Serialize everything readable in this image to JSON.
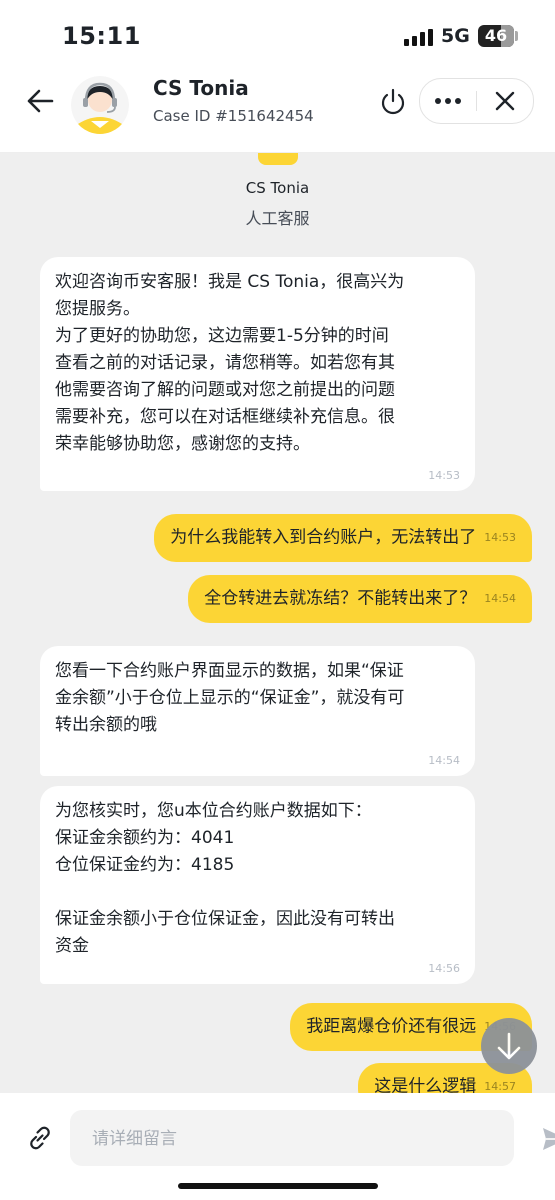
{
  "status_bar": {
    "time": "15:11",
    "network": "5G",
    "battery": "46"
  },
  "header": {
    "agent_name": "CS Tonia",
    "case_id": "Case ID #151642454"
  },
  "system": {
    "agent_name": "CS Tonia",
    "role": "人工客服"
  },
  "messages": [
    {
      "direction": "in",
      "text": "欢迎咨询币安客服！我是 CS Tonia，很高兴为\n您提服务。\n为了更好的协助您，这边需要1-5分钟的时间\n查看之前的对话记录，请您稍等。如若您有其\n他需要咨询了解的问题或对您之前提出的问题\n需要补充，您可以在对话框继续补充信息。很\n荣幸能够协助您，感谢您的支持。",
      "time": "14:53"
    },
    {
      "direction": "out",
      "text": "为什么我能转入到合约账户，无法转出了",
      "time": "14:53"
    },
    {
      "direction": "out",
      "text": "全仓转进去就冻结？不能转出来了？",
      "time": "14:54"
    },
    {
      "direction": "in",
      "text": "您看一下合约账户界面显示的数据，如果“保证\n金余额”小于仓位上显示的“保证金”，就没有可\n转出余额的哦",
      "time": "14:54"
    },
    {
      "direction": "in",
      "text": "为您核实时，您u本位合约账户数据如下：\n保证金余额约为：4041\n仓位保证金约为：4185\n\n保证金余额小于仓位保证金，因此没有可转出\n资金",
      "time": "14:56"
    },
    {
      "direction": "out",
      "text": "我距离爆仓价还有很远",
      "time": "14:56"
    },
    {
      "direction": "out",
      "text": "这是什么逻辑",
      "time": "14:57"
    }
  ],
  "composer": {
    "placeholder": "请详细留言"
  },
  "colors": {
    "accent": "#fcd535",
    "chat_bg": "#efefef",
    "text": "#1e2329"
  },
  "icons": [
    "back-arrow-icon",
    "agent-avatar-icon",
    "power-icon",
    "more-icon",
    "close-icon",
    "arrow-down-icon",
    "link-icon",
    "send-icon"
  ]
}
